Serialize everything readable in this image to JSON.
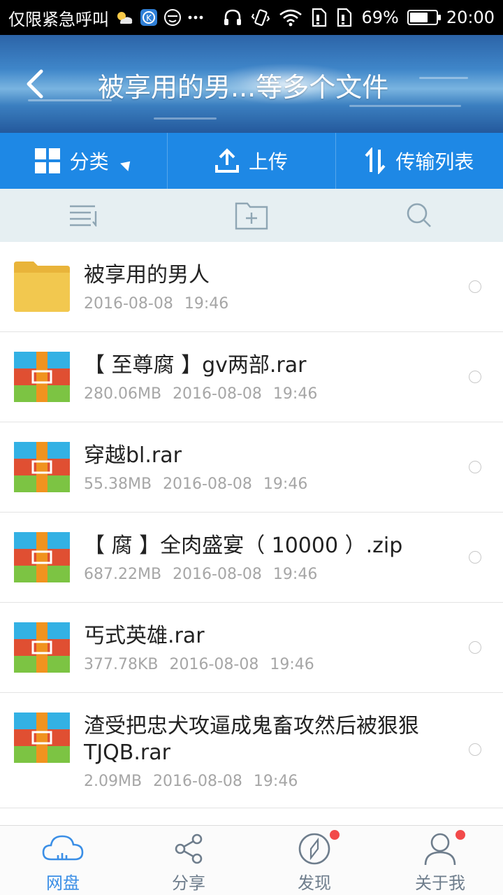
{
  "status_bar": {
    "carrier_text": "仅限紧急呼叫",
    "battery_percent": "69%",
    "battery_level": 0.69,
    "time": "20:00",
    "icons": [
      "weather-icon",
      "k-app-icon",
      "face-app-icon",
      "more-icon",
      "headphone-icon",
      "vibrate-icon",
      "wifi-icon",
      "sim-icon",
      "sim2-icon",
      "battery-icon"
    ]
  },
  "header": {
    "title": "被享用的男...等多个文件"
  },
  "action_bar": {
    "category_label": "分类",
    "upload_label": "上传",
    "transfer_label": "传输列表"
  },
  "files": [
    {
      "type": "folder",
      "name": "被享用的男人",
      "size": "",
      "date": "2016-08-08",
      "time": "19:46"
    },
    {
      "type": "archive",
      "name": "【 至尊腐 】gv两部.rar",
      "size": "280.06MB",
      "date": "2016-08-08",
      "time": "19:46"
    },
    {
      "type": "archive",
      "name": "穿越bl.rar",
      "size": "55.38MB",
      "date": "2016-08-08",
      "time": "19:46"
    },
    {
      "type": "archive",
      "name": "【 腐 】全肉盛宴（ 10000 ）.zip",
      "size": "687.22MB",
      "date": "2016-08-08",
      "time": "19:46"
    },
    {
      "type": "archive",
      "name": "丐式英雄.rar",
      "size": "377.78KB",
      "date": "2016-08-08",
      "time": "19:46"
    },
    {
      "type": "archive",
      "name": "渣受把忠犬攻逼成鬼畜攻然后被狠狠TJQB.rar",
      "size": "2.09MB",
      "date": "2016-08-08",
      "time": "19:46"
    }
  ],
  "bottom_nav": [
    {
      "label": "网盘",
      "icon": "cloud-icon",
      "active": true,
      "badge": false
    },
    {
      "label": "分享",
      "icon": "share-icon",
      "active": false,
      "badge": false
    },
    {
      "label": "发现",
      "icon": "compass-icon",
      "active": false,
      "badge": true
    },
    {
      "label": "关于我",
      "icon": "user-icon",
      "active": false,
      "badge": true
    }
  ],
  "colors": {
    "action_bar": "#1e88e5",
    "toolbar": "#e6eff2",
    "active_nav": "#3a8ee6",
    "inactive_nav": "#6e7d8c",
    "badge": "#f24a4a",
    "folder": "#f2c04a"
  }
}
